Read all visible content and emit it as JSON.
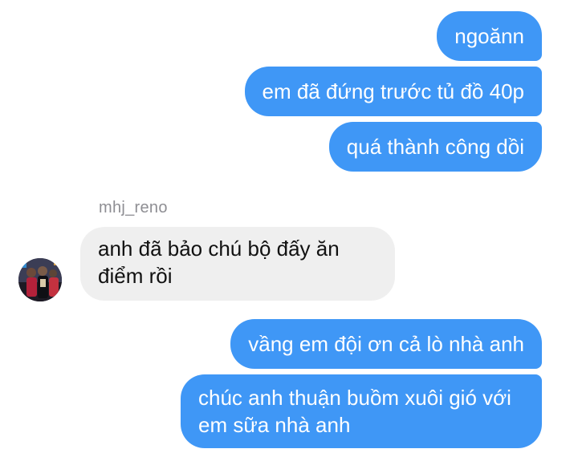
{
  "conversation": {
    "messages": [
      {
        "direction": "outgoing",
        "text": "ngoănn"
      },
      {
        "direction": "outgoing",
        "text": "em đã đứng trước tủ đồ 40p"
      },
      {
        "direction": "outgoing",
        "text": "quá thành công dồi"
      },
      {
        "direction": "incoming",
        "sender": "mhj_reno",
        "text": "anh đã bảo chú bộ đấy ăn điểm rồi"
      },
      {
        "direction": "outgoing",
        "text": "vầng em đội ơn cả lò nhà anh"
      },
      {
        "direction": "outgoing",
        "text": "chúc anh thuận buồm xuôi gió với em sữa nhà anh"
      }
    ],
    "sender_name": "mhj_reno"
  },
  "colors": {
    "outgoing_bubble": "#3f97f6",
    "incoming_bubble": "#efefef",
    "sender_label": "#8e8e93"
  },
  "icons": {
    "avatar": "user-avatar-photo"
  }
}
